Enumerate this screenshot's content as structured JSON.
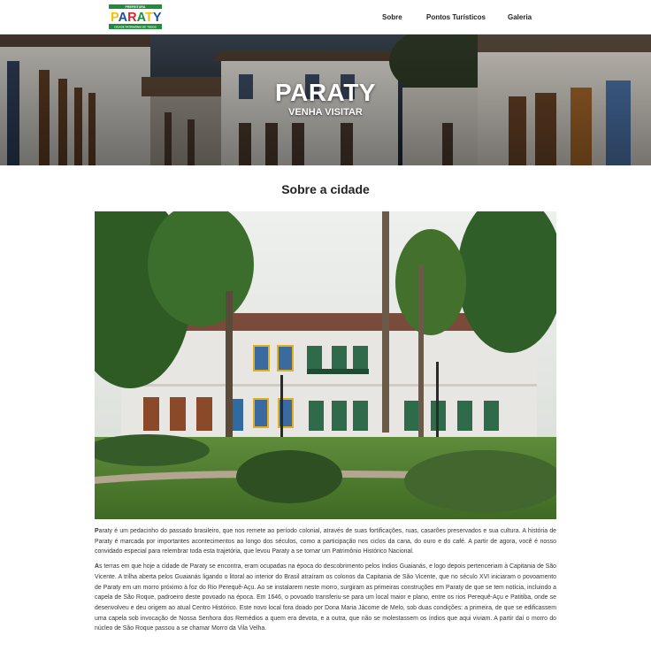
{
  "navbar": {
    "logo": {
      "top_text": "PREFEITURA",
      "brand": "PARATY",
      "bottom_text": "CIDADE PATRIMÔNIO DE TODOS"
    },
    "links": {
      "sobre": "Sobre",
      "pontos": "Pontos Turísticos",
      "galeria": "Galeria"
    }
  },
  "hero": {
    "title": "PARATY",
    "subtitle": "VENHA VISITAR"
  },
  "about": {
    "title": "Sobre a cidade",
    "paragraphs": [
      {
        "lead": "P",
        "text": "araty é um pedacinho do passado brasileiro, que nos remete ao período colonial, através de suas fortificações, ruas, casarões preservados e sua cultura. A história de Paraty é marcada por importantes acontecimentos ao longo dos séculos, como a participação nos ciclos da cana, do ouro e do café. A partir de agora, você é nosso convidado especial para relembrar toda esta trajetória, que levou Paraty a se tornar um Patrimônio Histórico Nacional."
      },
      {
        "lead": "A",
        "text": "s terras em que hoje a cidade de Paraty se encontra, eram ocupadas na época do descobrimento pelos índios Guaianás, e logo depois pertenceriam à Capitania de São Vicente. A trilha aberta pelos Guaianás ligando o litoral ao interior do Brasil atraíram os colonos da Capitania de São Vicente, que no século XVI iniciaram o povoamento de Paraty em um morro próximo à foz do Rio Perequê-Açu. Ao se instalarem neste morro, surgiram as primeiras construções em Paraty de que se tem notícia, incluindo a capela de São Roque, padroeiro deste povoado na época. Em 1646, o povoado transferiu-se para um local maior e plano, entre os rios Perequê-Açu e Patitiba, onde se desenvolveu e deu origem ao atual Centro Histórico. Este novo local fora doado por Dona Maria Jácome de Melo, sob duas condições: a primeira, de que se edificassem uma capela sob invocação de Nossa Senhora dos Remédios a quem era devota, e a outra, que não se molestassem os índios que aqui viviam. A partir daí o morro do núcleo de São Roque passou a se chamar Morro da Vila Velha."
      }
    ]
  },
  "colors": {
    "logo_green": "#1e8c3a",
    "logo_yellow": "#f6c200",
    "logo_blue": "#1a4fa0",
    "logo_red": "#d8262e"
  }
}
